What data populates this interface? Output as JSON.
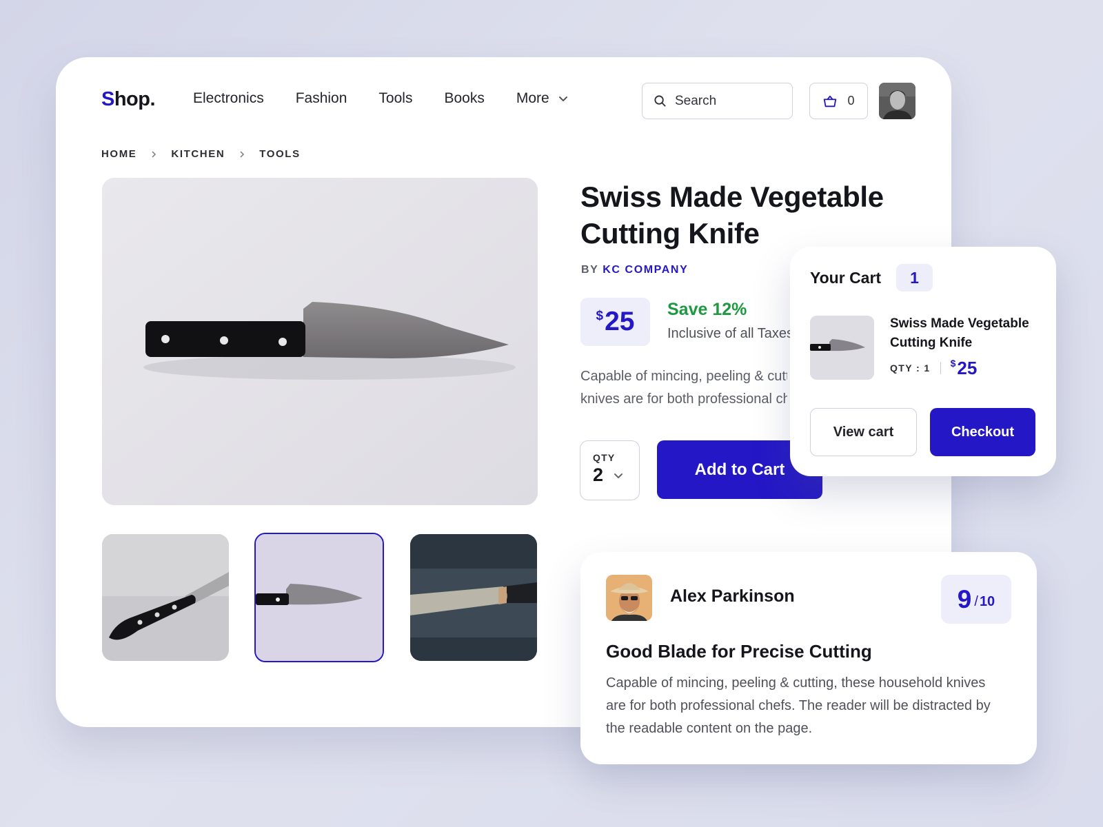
{
  "header": {
    "logo_s": "S",
    "logo_rest": "hop.",
    "nav": [
      "Electronics",
      "Fashion",
      "Tools",
      "Books",
      "More"
    ],
    "search_placeholder": "Search",
    "cart_count": "0"
  },
  "breadcrumb": [
    "HOME",
    "KITCHEN",
    "TOOLS"
  ],
  "product": {
    "title": "Swiss Made Vegetable Cutting Knife",
    "by": "BY",
    "brand": "KC COMPANY",
    "currency": "$",
    "price": "25",
    "save": "Save 12%",
    "tax": "Inclusive of all Taxes",
    "description": "Capable of mincing, peeling & cutting, these household knives are for both professional chefs.",
    "desc_line1": "Capable of mincing, peeling & cutting,",
    "desc_line2": "knives are for both professional chefs.",
    "qty_label": "QTY",
    "qty_value": "2",
    "add_to_cart": "Add to Cart"
  },
  "cart_popup": {
    "title": "Your Cart",
    "count": "1",
    "item_name": "Swiss Made Vegetable Cutting Knife",
    "item_qty": "QTY : 1",
    "item_currency": "$",
    "item_price": "25",
    "view_cart": "View cart",
    "checkout": "Checkout"
  },
  "review": {
    "name": "Alex Parkinson",
    "score": "9",
    "score_slash": "/",
    "score_max": "10",
    "title": "Good Blade for Precise Cutting",
    "text": "Capable of mincing, peeling & cutting, these household knives are for both professional chefs. The reader will be distracted by the readable content on the page."
  },
  "colors": {
    "accent": "#2418c6",
    "save_green": "#1d9a40",
    "accent_soft": "#eeeefb",
    "background": "#d9dcec"
  },
  "icons": [
    "search-icon",
    "basket-icon",
    "chevron-down-icon",
    "chevron-right-icon"
  ]
}
